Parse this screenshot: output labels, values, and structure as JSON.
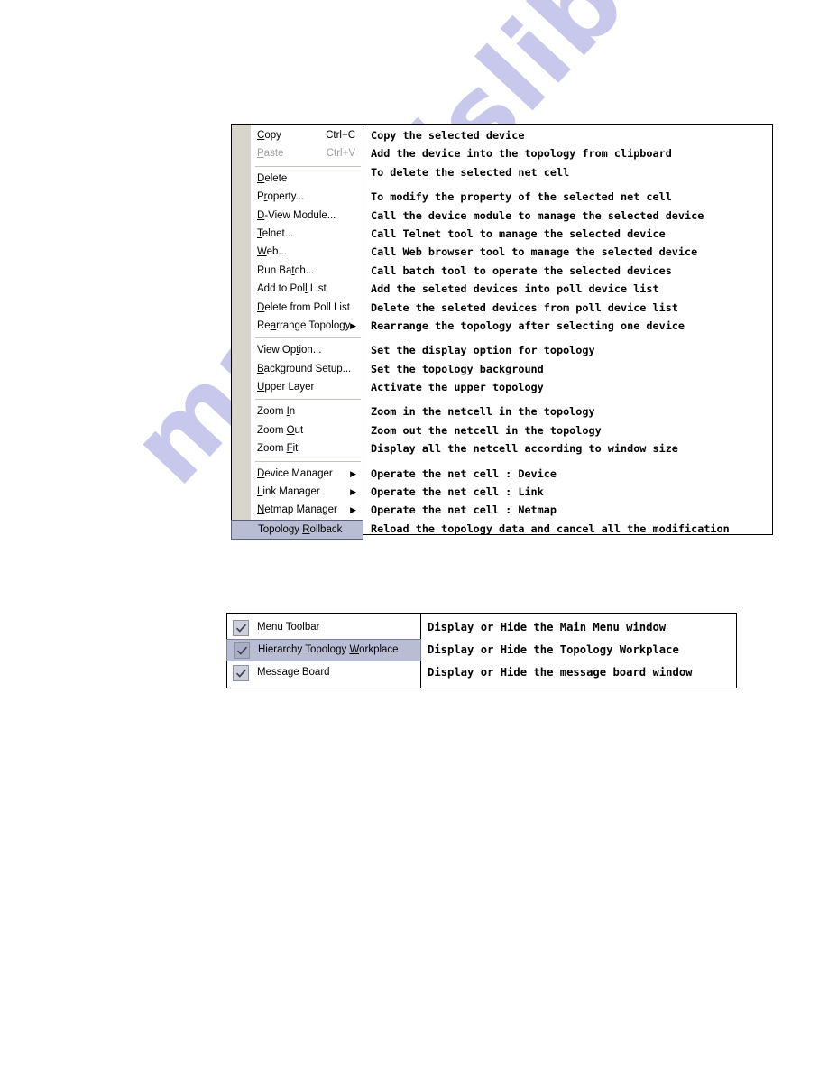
{
  "watermark": {
    "text": "manualslib.com",
    "color": "#c8c8ec"
  },
  "context_menu_panel": {
    "menu": {
      "items": [
        {
          "type": "item",
          "label": "Copy",
          "mnemonic_index": 0,
          "accel": "Ctrl+C",
          "disabled": false,
          "submenu": false,
          "selected": false
        },
        {
          "type": "item",
          "label": "Paste",
          "mnemonic_index": 0,
          "accel": "Ctrl+V",
          "disabled": true,
          "submenu": false,
          "selected": false
        },
        {
          "type": "separator"
        },
        {
          "type": "item",
          "label": "Delete",
          "mnemonic_index": 0,
          "accel": "",
          "disabled": false,
          "submenu": false,
          "selected": false
        },
        {
          "type": "item",
          "label": "Property...",
          "mnemonic_index": 1,
          "accel": "",
          "disabled": false,
          "submenu": false,
          "selected": false
        },
        {
          "type": "item",
          "label": "D-View Module...",
          "mnemonic_index": 0,
          "accel": "",
          "disabled": false,
          "submenu": false,
          "selected": false
        },
        {
          "type": "item",
          "label": "Telnet...",
          "mnemonic_index": 0,
          "accel": "",
          "disabled": false,
          "submenu": false,
          "selected": false
        },
        {
          "type": "item",
          "label": "Web...",
          "mnemonic_index": 0,
          "accel": "",
          "disabled": false,
          "submenu": false,
          "selected": false
        },
        {
          "type": "item",
          "label": "Run Batch...",
          "mnemonic_index": 6,
          "accel": "",
          "disabled": false,
          "submenu": false,
          "selected": false
        },
        {
          "type": "item",
          "label": "Add to Poll List",
          "mnemonic_index": 10,
          "accel": "",
          "disabled": false,
          "submenu": false,
          "selected": false
        },
        {
          "type": "item",
          "label": "Delete from Poll List",
          "mnemonic_index": 0,
          "accel": "",
          "disabled": false,
          "submenu": false,
          "selected": false
        },
        {
          "type": "item",
          "label": "Rearrange Topology",
          "mnemonic_index": 2,
          "accel": "",
          "disabled": false,
          "submenu": true,
          "selected": false
        },
        {
          "type": "separator"
        },
        {
          "type": "item",
          "label": "View Option...",
          "mnemonic_index": 7,
          "accel": "",
          "disabled": false,
          "submenu": false,
          "selected": false
        },
        {
          "type": "item",
          "label": "Background Setup...",
          "mnemonic_index": 0,
          "accel": "",
          "disabled": false,
          "submenu": false,
          "selected": false
        },
        {
          "type": "item",
          "label": "Upper Layer",
          "mnemonic_index": 0,
          "accel": "",
          "disabled": false,
          "submenu": false,
          "selected": false
        },
        {
          "type": "separator"
        },
        {
          "type": "item",
          "label": "Zoom In",
          "mnemonic_index": 5,
          "accel": "",
          "disabled": false,
          "submenu": false,
          "selected": false
        },
        {
          "type": "item",
          "label": "Zoom Out",
          "mnemonic_index": 5,
          "accel": "",
          "disabled": false,
          "submenu": false,
          "selected": false
        },
        {
          "type": "item",
          "label": "Zoom Fit",
          "mnemonic_index": 5,
          "accel": "",
          "disabled": false,
          "submenu": false,
          "selected": false
        },
        {
          "type": "separator"
        },
        {
          "type": "item",
          "label": "Device Manager",
          "mnemonic_index": 0,
          "accel": "",
          "disabled": false,
          "submenu": true,
          "selected": false
        },
        {
          "type": "item",
          "label": "Link Manager",
          "mnemonic_index": 0,
          "accel": "",
          "disabled": false,
          "submenu": true,
          "selected": false
        },
        {
          "type": "item",
          "label": "Netmap Manager",
          "mnemonic_index": 0,
          "accel": "",
          "disabled": false,
          "submenu": true,
          "selected": false
        },
        {
          "type": "item",
          "label": "Topology Rollback",
          "mnemonic_index": 9,
          "accel": "",
          "disabled": false,
          "submenu": false,
          "selected": true
        }
      ]
    },
    "descriptions": [
      {
        "type": "line",
        "text": "Copy the selected device"
      },
      {
        "type": "line",
        "text": "Add the device into the topology from clipboard"
      },
      {
        "type": "line",
        "text": "To delete the selected net cell"
      },
      {
        "type": "gap"
      },
      {
        "type": "line",
        "text": "To modify the property of the selected net cell"
      },
      {
        "type": "line",
        "text": "Call the device module to manage the selected device"
      },
      {
        "type": "line",
        "text": "Call Telnet tool to manage the selected device"
      },
      {
        "type": "line",
        "text": "Call Web browser tool to manage the selected device"
      },
      {
        "type": "line",
        "text": "Call batch tool to operate the selected devices"
      },
      {
        "type": "line",
        "text": "Add the seleted devices into poll device list"
      },
      {
        "type": "line",
        "text": "Delete the seleted devices from poll device list"
      },
      {
        "type": "line",
        "text": "Rearrange the topology after selecting one device"
      },
      {
        "type": "gap"
      },
      {
        "type": "line",
        "text": "Set the display option for topology"
      },
      {
        "type": "line",
        "text": "Set the topology background"
      },
      {
        "type": "line",
        "text": "Activate the upper topology"
      },
      {
        "type": "gap"
      },
      {
        "type": "line",
        "text": "Zoom in the netcell in the topology"
      },
      {
        "type": "line",
        "text": "Zoom out the netcell in the topology"
      },
      {
        "type": "line",
        "text": "Display all the netcell according to window size"
      },
      {
        "type": "gap"
      },
      {
        "type": "line",
        "text": "Operate the net cell : Device"
      },
      {
        "type": "line",
        "text": "Operate the net cell : Link"
      },
      {
        "type": "line",
        "text": "Operate the net cell : Netmap"
      },
      {
        "type": "line",
        "text": "Reload the topology data and cancel all the modification"
      }
    ]
  },
  "view_menu_panel": {
    "items": [
      {
        "label": "Menu Toolbar",
        "checked": true,
        "selected": false,
        "mnemonic_index": -1
      },
      {
        "label": "Hierarchy Topology Workplace",
        "checked": true,
        "selected": true,
        "mnemonic_index": 19
      },
      {
        "label": "Message Board",
        "checked": true,
        "selected": false,
        "mnemonic_index": -1
      }
    ],
    "descriptions": [
      "Display or Hide the Main Menu window",
      "Display or Hide the Topology Workplace",
      "Display or Hide the message board window"
    ]
  }
}
